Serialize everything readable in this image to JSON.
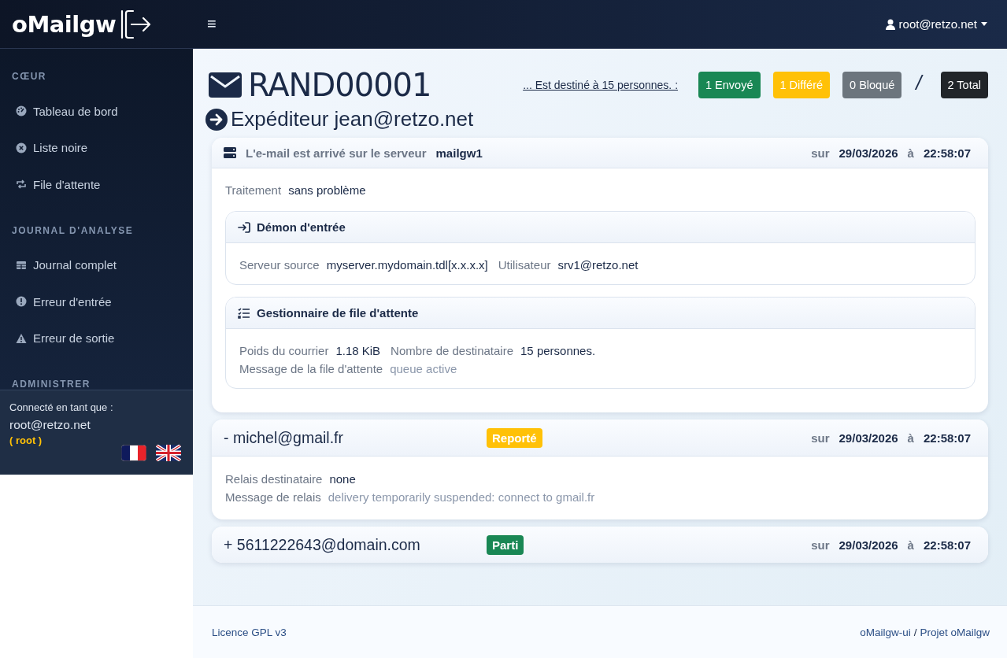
{
  "brand": {
    "name": "oMailgw"
  },
  "topbar": {
    "menu_glyph": "≡",
    "user": "root@retzo.net"
  },
  "sidebar": {
    "sections": [
      {
        "heading": "CŒUR",
        "items": [
          {
            "label": "Tableau de bord"
          },
          {
            "label": "Liste noire"
          },
          {
            "label": "File d'attente"
          }
        ]
      },
      {
        "heading": "JOURNAL D'ANALYSE",
        "items": [
          {
            "label": "Journal complet"
          },
          {
            "label": "Erreur d'entrée"
          },
          {
            "label": "Erreur de sortie"
          }
        ]
      },
      {
        "heading": "ADMINISTRER"
      }
    ],
    "account": {
      "caption": "Connecté en tant que :",
      "user": "root@retzo.net",
      "role": "( root )"
    }
  },
  "header": {
    "id": "RAND00001",
    "recipients_link": "... Est destiné à 15 personnes. :",
    "counts": [
      {
        "text": "1 Envoyé",
        "color": "#198754"
      },
      {
        "text": "1 Différé",
        "color": "#ffc107"
      },
      {
        "text": "0 Bloqué",
        "color": "#6c757d"
      }
    ],
    "separator": "/",
    "total": {
      "text": "2 Total",
      "color": "#212529"
    }
  },
  "sender": "Expéditeur jean@retzo.net",
  "arrival": {
    "title": "L'e-mail est arrivé sur le serveur",
    "server": "mailgw1",
    "on": "sur",
    "date": "29/03/2026",
    "at": "à",
    "time": "22:58:07",
    "fields": [
      [
        {
          "label": "Traitement",
          "value": "sans problème",
          "muted": false
        }
      ]
    ],
    "panels": [
      {
        "title": "Démon d'entrée",
        "lines": [
          [
            {
              "label": "Serveur source",
              "value": "myserver.mydomain.tdl[x.x.x.x]",
              "muted": false
            },
            {
              "label": "Utilisateur",
              "value": "srv1@retzo.net",
              "muted": false
            }
          ]
        ]
      },
      {
        "title": "Gestionnaire de file d'attente",
        "lines": [
          [
            {
              "label": "Poids du courrier",
              "value": "1.18 KiB",
              "muted": false
            },
            {
              "label": "Nombre de destinataire",
              "value": "15 personnes.",
              "muted": false
            }
          ],
          [
            {
              "label": "Message de la file d'attente",
              "value": "queue active",
              "muted": true
            }
          ]
        ]
      }
    ]
  },
  "recipients": [
    {
      "address": "- michel@gmail.fr",
      "status": "Reporté",
      "color": "#ffc107",
      "on": "sur",
      "date": "29/03/2026",
      "at": "à",
      "time": "22:58:07",
      "expanded": true,
      "lines": [
        [
          {
            "label": "Relais destinataire",
            "value": "none",
            "muted": false
          }
        ],
        [
          {
            "label": "Message de relais",
            "value": "delivery temporarily suspended: connect to gmail.fr",
            "muted": true
          }
        ]
      ]
    },
    {
      "address": "+ 5611222643@domain.com",
      "status": "Parti",
      "color": "#198754",
      "on": "sur",
      "date": "29/03/2026",
      "at": "à",
      "time": "22:58:07",
      "expanded": false
    }
  ],
  "footer": {
    "license": "Licence GPL v3",
    "links": [
      "oMailgw-ui",
      "Projet oMailgw"
    ],
    "separator": "/"
  }
}
